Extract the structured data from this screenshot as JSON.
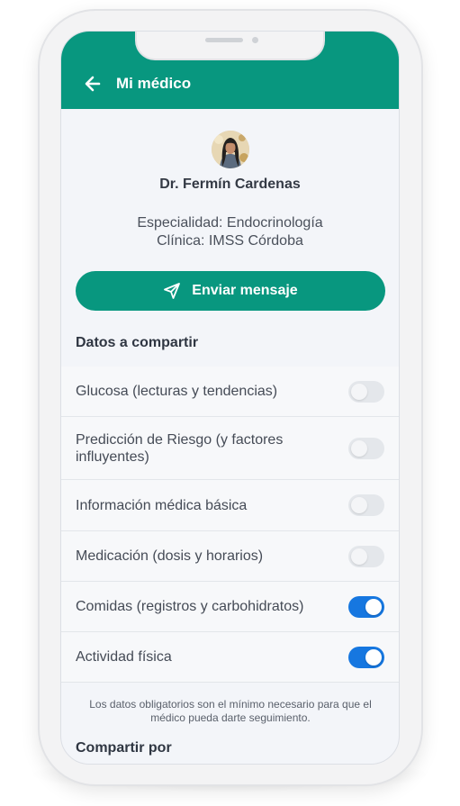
{
  "header": {
    "title": "Mi médico",
    "back_icon": "arrow-left-icon",
    "color": "#08977f"
  },
  "doctor": {
    "avatar_icon": "doctor-avatar",
    "name": "Dr. Fermín Cardenas",
    "specialty": "Especialidad: Endocrinología",
    "clinic": "Clínica: IMSS Córdoba"
  },
  "actions": {
    "send_label": "Enviar mensaje",
    "send_icon": "send-icon"
  },
  "sharing": {
    "title": "Datos a compartir",
    "items": [
      {
        "label": "Glucosa (lecturas y tendencias)",
        "enabled": true,
        "locked": true
      },
      {
        "label": "Predicción de Riesgo (y factores influyentes)",
        "enabled": true,
        "locked": true
      },
      {
        "label": "Información médica básica",
        "enabled": true,
        "locked": true
      },
      {
        "label": "Medicación (dosis y horarios)",
        "enabled": true,
        "locked": true
      },
      {
        "label": "Comidas (registros y carbohidratos)",
        "enabled": true,
        "locked": false
      },
      {
        "label": "Actividad física",
        "enabled": true,
        "locked": false
      }
    ],
    "note": "Los datos obligatorios son el mínimo necesario para que el médico pueda darte seguimiento."
  },
  "share_by": {
    "title": "Compartir por"
  },
  "colors": {
    "accent": "#08977f",
    "toggle_on": "#1677e0",
    "toggle_disabled": "#e4e7eb"
  }
}
